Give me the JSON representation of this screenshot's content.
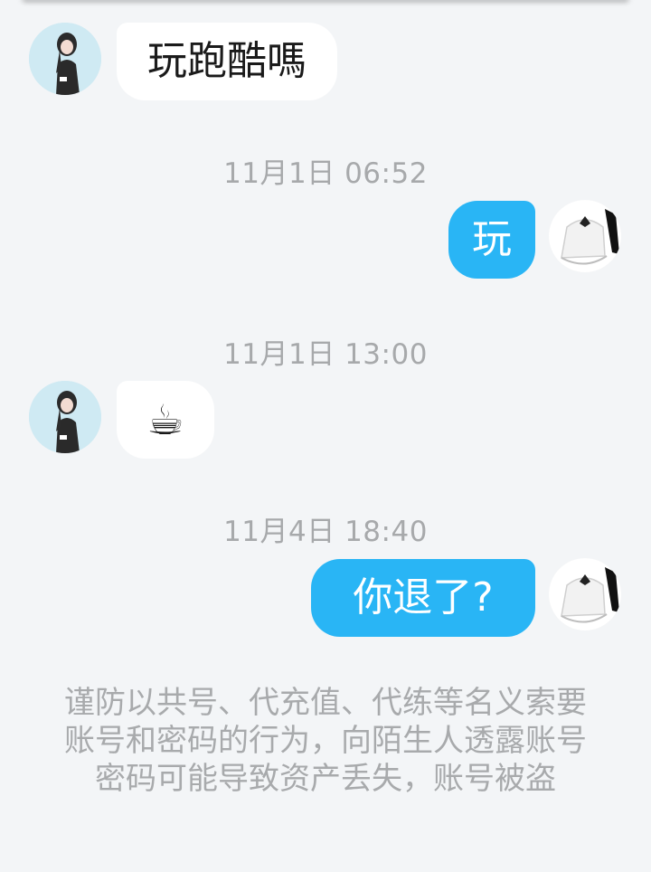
{
  "messages": [
    {
      "side": "in",
      "text": "玩跑酷嗎",
      "avatar": "anime-girl-avatar"
    },
    {
      "timestamp": "11月1日 06:52"
    },
    {
      "side": "out",
      "text": "玩",
      "avatar": "white-dress-avatar"
    },
    {
      "timestamp": "11月1日 13:00"
    },
    {
      "side": "in",
      "text": "☕",
      "avatar": "anime-girl-avatar"
    },
    {
      "timestamp": "11月4日 18:40"
    },
    {
      "side": "out",
      "text": "你退了?",
      "avatar": "white-dress-avatar"
    }
  ],
  "security_notice": "谨防以共号、代充值、代练等名义索要账号和密码的行为，向陌生人透露账号密码可能导致资产丢失，账号被盗",
  "colors": {
    "background": "#f3f5f7",
    "outgoing_bubble": "#29b5f5",
    "incoming_bubble": "#ffffff",
    "meta_text": "#a7a9ab"
  }
}
